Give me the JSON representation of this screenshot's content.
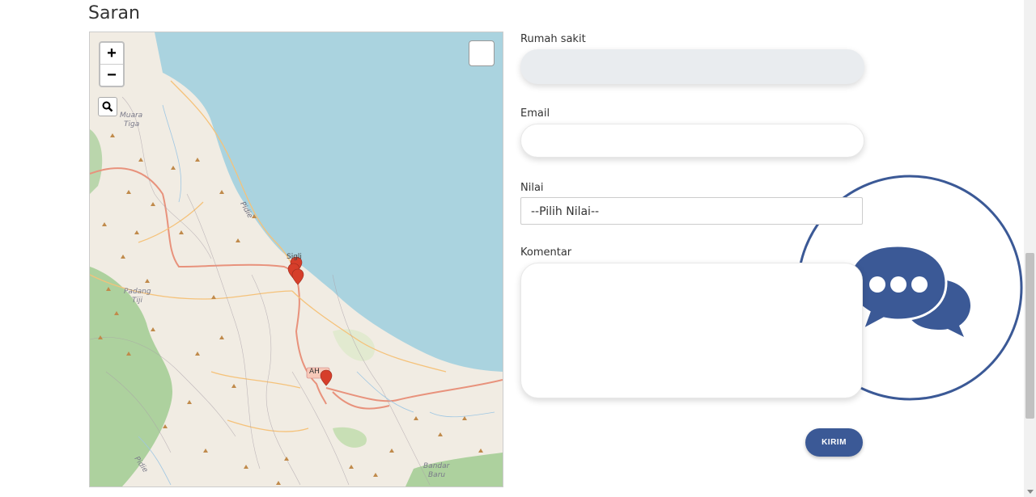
{
  "section_title": "Saran",
  "map": {
    "zoom_in": "+",
    "zoom_out": "−",
    "labels": {
      "muara_tiga_1": "Muara",
      "muara_tiga_2": "Tiga",
      "pidie_coast": "Pidie",
      "sigli": "Sigli",
      "padang_tiji_1": "Padang",
      "padang_tiji_2": "Tiji",
      "ah": "AH",
      "pidie_south": "Pidie",
      "bandar_baru_1": "Bandar",
      "bandar_baru_2": "Baru"
    },
    "colors": {
      "sea": "#aad3df",
      "land": "#f1ece3",
      "forest": "#add19e",
      "marker": "#d63e2a",
      "road": "#e8927c"
    }
  },
  "form": {
    "hospital_label": "Rumah sakit",
    "hospital_value": "",
    "email_label": "Email",
    "email_value": "",
    "rating_label": "Nilai",
    "rating_selected": "--Pilih Nilai--",
    "comment_label": "Komentar",
    "comment_value": "",
    "submit_label": "KIRIM"
  },
  "colors": {
    "accent": "#3b5996"
  }
}
